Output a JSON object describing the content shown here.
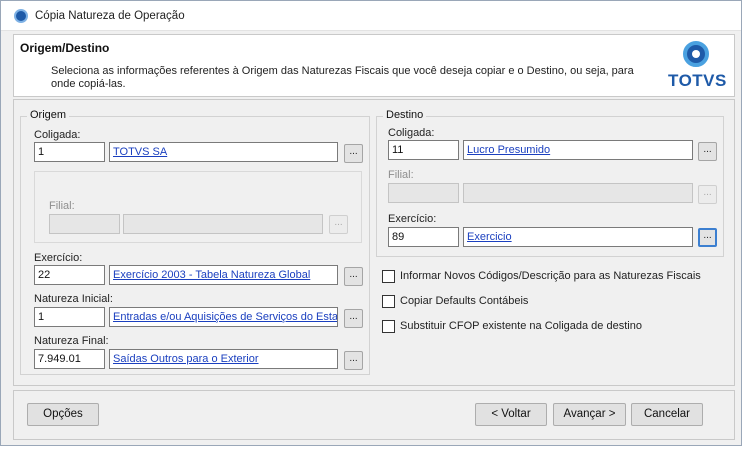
{
  "window": {
    "title": "Cópia Natureza de Operação"
  },
  "header": {
    "title": "Origem/Destino",
    "description": "Seleciona as informações referentes à Origem das Naturezas Fiscais que você deseja copiar e o Destino, ou seja, para onde copiá-las.",
    "logo_text": "TOTVS"
  },
  "origem": {
    "group_label": "Origem",
    "coligada": {
      "label": "Coligada:",
      "code": "1",
      "name": "TOTVS SA"
    },
    "filial": {
      "label": "Filial:",
      "code": "",
      "name": ""
    },
    "exercicio": {
      "label": "Exercício:",
      "code": "22",
      "name": "Exercício 2003 - Tabela Natureza Global"
    },
    "natureza_inicial": {
      "label": "Natureza Inicial:",
      "code": "1",
      "name": "Entradas e/ou Aquisições de Serviços do Estac"
    },
    "natureza_final": {
      "label": "Natureza Final:",
      "code": "7.949.01",
      "name": "Saídas Outros para o Exterior"
    }
  },
  "destino": {
    "group_label": "Destino",
    "coligada": {
      "label": "Coligada:",
      "code": "11",
      "name": "Lucro Presumido"
    },
    "filial": {
      "label": "Filial:",
      "code": "",
      "name": ""
    },
    "exercicio": {
      "label": "Exercício:",
      "code": "89",
      "name": "Exercicio"
    }
  },
  "lookup_button_label": "...",
  "options": [
    {
      "label": "Informar Novos Códigos/Descrição para as Naturezas Fiscais",
      "checked": false
    },
    {
      "label": "Copiar Defaults Contábeis",
      "checked": false
    },
    {
      "label": "Substituir CFOP existente na Coligada de destino",
      "checked": false
    }
  ],
  "footer": {
    "options_button": "Opções",
    "back_button": "< Voltar",
    "next_button": "Avançar >",
    "cancel_button": "Cancelar"
  },
  "colors": {
    "link": "#1a3fbf",
    "brand": "#1e5aa8",
    "focus": "#3c7fd0"
  }
}
